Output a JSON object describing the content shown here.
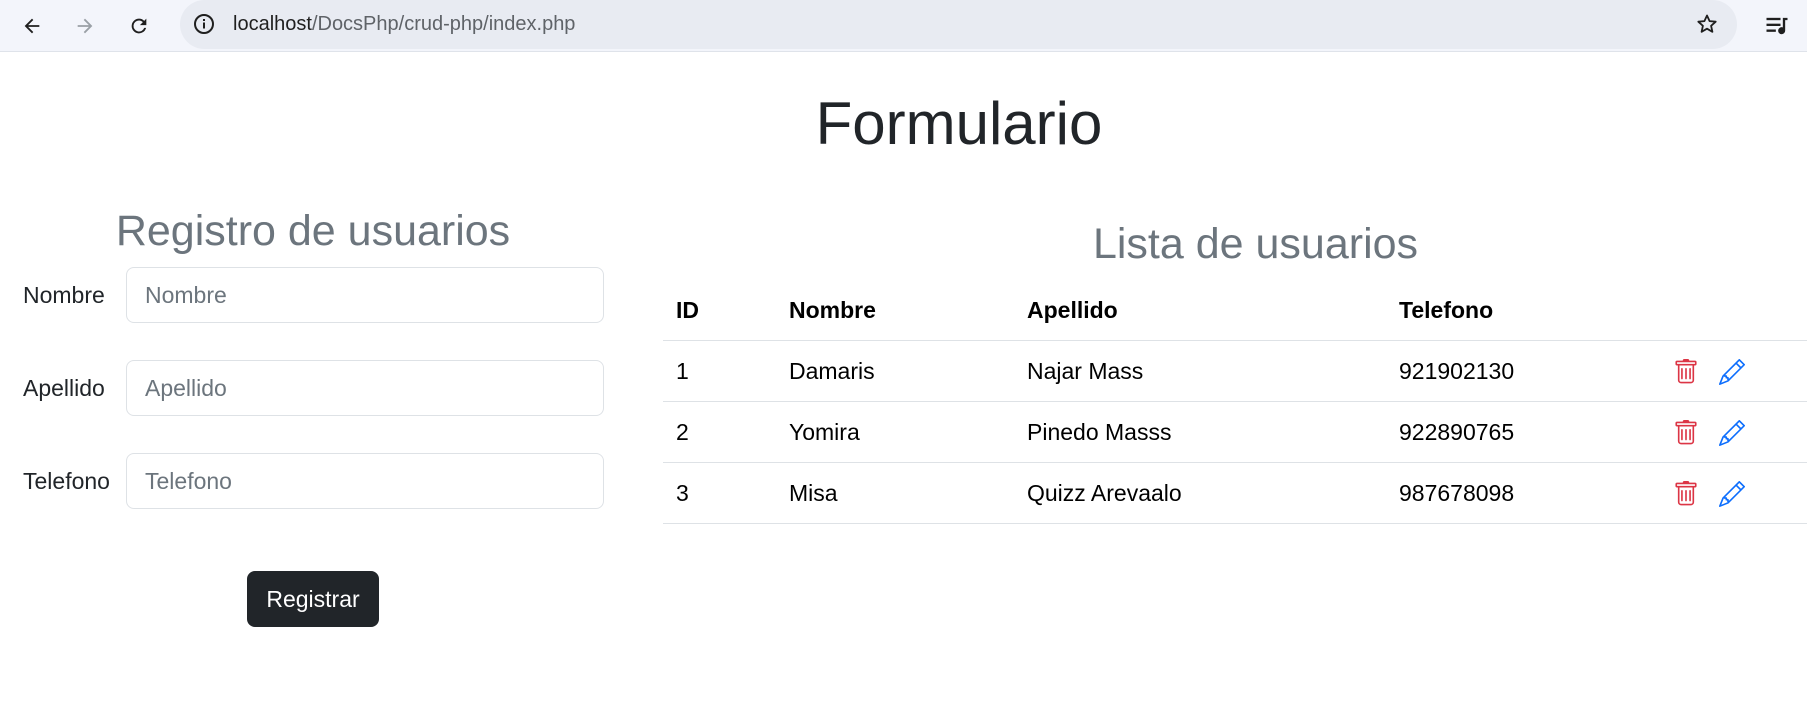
{
  "browser": {
    "url_host": "localhost",
    "url_path": "/DocsPhp/crud-php/index.php"
  },
  "page": {
    "title": "Formulario"
  },
  "form": {
    "title": "Registro de usuarios",
    "fields": [
      {
        "label": "Nombre",
        "placeholder": "Nombre",
        "value": ""
      },
      {
        "label": "Apellido",
        "placeholder": "Apellido",
        "value": ""
      },
      {
        "label": "Telefono",
        "placeholder": "Telefono",
        "value": ""
      }
    ],
    "submit_label": "Registrar"
  },
  "list": {
    "title": "Lista de usuarios",
    "columns": [
      "ID",
      "Nombre",
      "Apellido",
      "Telefono"
    ],
    "rows": [
      {
        "id": "1",
        "nombre": "Damaris",
        "apellido": "Najar Mass",
        "telefono": "921902130"
      },
      {
        "id": "2",
        "nombre": "Yomira",
        "apellido": "Pinedo Masss",
        "telefono": "922890765"
      },
      {
        "id": "3",
        "nombre": "Misa",
        "apellido": "Quizz Arevaalo",
        "telefono": "987678098"
      }
    ]
  },
  "icons": {
    "delete": "trash-icon",
    "edit": "pencil-icon"
  },
  "colors": {
    "delete": "#dc3545",
    "edit": "#0d6efd",
    "button": "#212529",
    "subtitle": "#6c757d"
  }
}
